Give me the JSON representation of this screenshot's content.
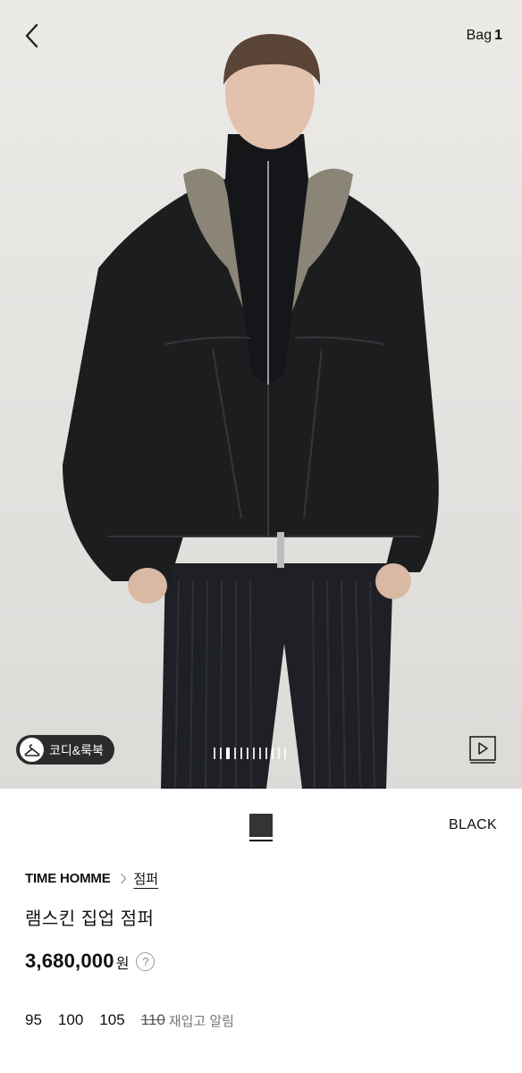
{
  "header": {
    "bag_label": "Bag",
    "bag_count": "1"
  },
  "gallery": {
    "coordi_label": "코디&룩북",
    "page_count": 12,
    "active_page": 3
  },
  "product": {
    "color": {
      "name": "BLACK",
      "swatch_hex": "#333436"
    },
    "brand": "TIME HOMME",
    "category": "점퍼",
    "name": "램스킨 집업 점퍼",
    "price": "3,680,000",
    "price_unit": "원",
    "help_icon": "question-circle-icon",
    "sizes": [
      {
        "label": "95",
        "available": true
      },
      {
        "label": "100",
        "available": true
      },
      {
        "label": "105",
        "available": true
      },
      {
        "label": "110",
        "available": false
      }
    ],
    "restock_label": "재입고 알림"
  }
}
